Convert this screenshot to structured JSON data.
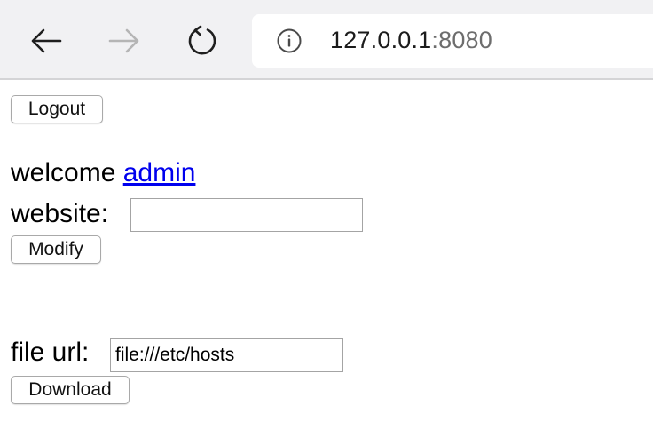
{
  "browser": {
    "url_host": "127.0.0.1",
    "url_port": ":8080",
    "back_icon": "arrow-left-icon",
    "forward_icon": "arrow-right-icon",
    "reload_icon": "reload-icon",
    "info_icon": "info-icon"
  },
  "page": {
    "logout_label": "Logout",
    "welcome_text": "welcome ",
    "welcome_user": "admin",
    "website_label": "website:",
    "website_value": "",
    "modify_label": "Modify",
    "fileurl_label": "file url:",
    "fileurl_value": "file:///etc/hosts",
    "download_label": "Download"
  },
  "colors": {
    "link": "#0000ee",
    "toolbar_bg": "#f1f1f3"
  }
}
